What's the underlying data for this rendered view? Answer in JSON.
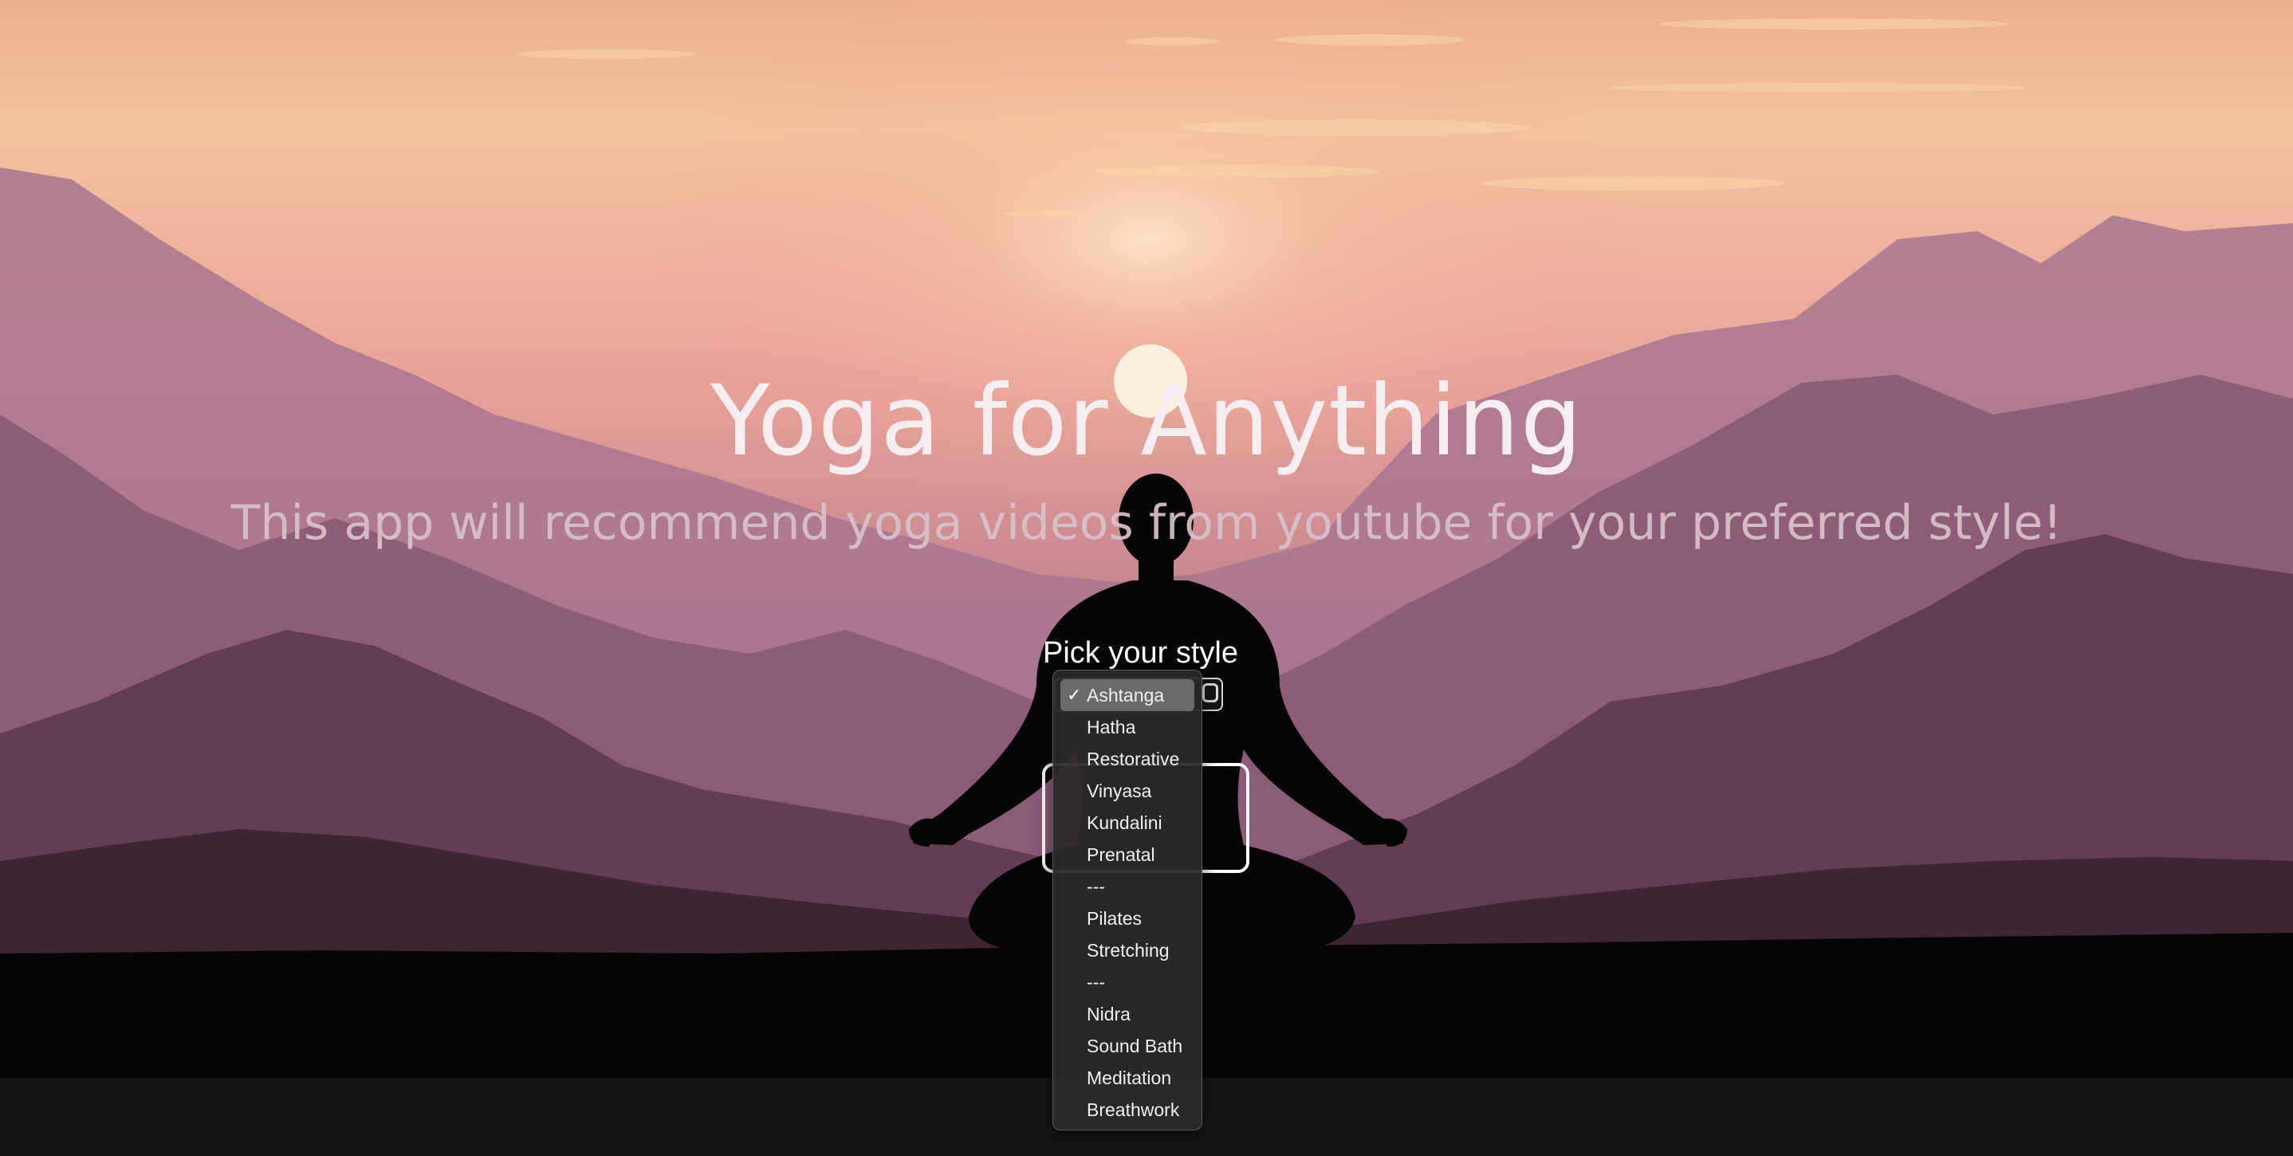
{
  "hero": {
    "title": "Yoga for Anything",
    "subtitle": "This app will recommend yoga videos from youtube for your preferred style!"
  },
  "style_picker": {
    "label": "Pick your style",
    "selected": "Ashtanga",
    "options": [
      "Ashtanga",
      "Hatha",
      "Restorative",
      "Vinyasa",
      "Kundalini",
      "Prenatal",
      "---",
      "Pilates",
      "Stretching",
      "---",
      "Nidra",
      "Sound Bath",
      "Meditation",
      "Breathwork"
    ]
  },
  "icons": {
    "selected_marker": "check-icon",
    "select_toggle": "chevron-updown-icon"
  },
  "colors": {
    "sky_top": "#f3c4a0",
    "sky_mid": "#e6989a",
    "mountains_far": "#b07d96",
    "mountains_near": "#4a2b3d",
    "ground": "#050505",
    "footer": "#141414"
  }
}
